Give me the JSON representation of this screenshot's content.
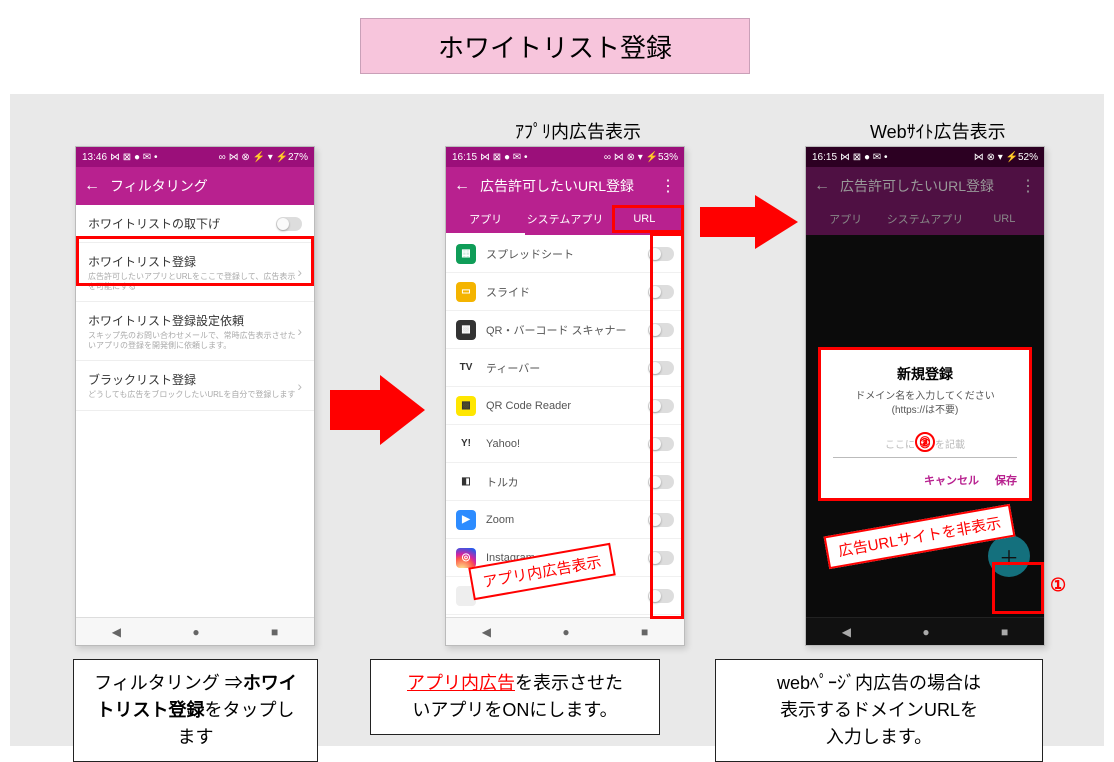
{
  "title": "ホワイトリスト登録",
  "column_labels": {
    "middle": "ｱﾌﾟﾘ内広告表示",
    "right": "Webｻｲﾄ広告表示"
  },
  "phone1": {
    "status_time": "13:46",
    "status_icons_left": "⋈ ⊠ ● ✉ •",
    "status_icons_right": "∞ ⋈ ⊗ ⚡ ▾ ⚡27%",
    "appbar_title": "フィルタリング",
    "items": [
      {
        "title": "ホワイトリストの取下げ",
        "sub": "",
        "type": "toggle"
      },
      {
        "title": "ホワイトリスト登録",
        "sub": "広告許可したいアプリとURLをここで登録して、広告表示を可能にする",
        "type": "chevron"
      },
      {
        "title": "ホワイトリスト登録設定依頼",
        "sub": "スキップ先のお問い合わせメールで、常時広告表示させたいアプリの登録を開発側に依頼します。",
        "type": "chevron"
      },
      {
        "title": "ブラックリスト登録",
        "sub": "どうしても広告をブロックしたいURLを自分で登録します",
        "type": "chevron"
      }
    ]
  },
  "phone2": {
    "status_time": "16:15",
    "status_icons_left": "⋈ ⊠ ● ✉ •",
    "status_icons_right": "∞ ⋈ ⊗ ▾ ⚡53%",
    "appbar_title": "広告許可したいURL登録",
    "tabs": [
      "アプリ",
      "システムアプリ",
      "URL"
    ],
    "active_tab_index": 0,
    "url_tab": "URL",
    "apps": [
      {
        "name": "スプレッドシート",
        "color": "#0f9d58",
        "glyph": "▦"
      },
      {
        "name": "スライド",
        "color": "#f4b400",
        "glyph": "▭"
      },
      {
        "name": "QR・バーコード スキャナー",
        "color": "#333333",
        "glyph": "▩"
      },
      {
        "name": "ティーバー",
        "color": "#ffffff",
        "glyph": "TV"
      },
      {
        "name": "QR Code Reader",
        "color": "#ffe600",
        "glyph": "▩"
      },
      {
        "name": "Yahoo!",
        "color": "#ffffff",
        "glyph": "Y!"
      },
      {
        "name": "トルカ",
        "color": "#ffffff",
        "glyph": "◧"
      },
      {
        "name": "Zoom",
        "color": "#2d8cff",
        "glyph": "▶"
      },
      {
        "name": "Instagram",
        "color": "#ffffff",
        "glyph": "◎"
      }
    ]
  },
  "phone3": {
    "status_time": "16:15",
    "status_icons_left": "⋈ ⊠ ● ✉ •",
    "status_icons_right": "⋈ ⊗ ▾ ⚡52%",
    "appbar_title": "広告許可したいURL登録",
    "tabs": [
      "アプリ",
      "システムアプリ",
      "URL"
    ],
    "dialog": {
      "title": "新規登録",
      "msg_line1": "ドメイン名を入力してください",
      "msg_line2": "(https://は不要)",
      "placeholder_left": "ここに",
      "placeholder_right": "を記載",
      "cancel": "キャンセル",
      "save": "保存"
    }
  },
  "callouts": {
    "middle": "アプリ内広告表示",
    "right": "広告URLサイトを非表示"
  },
  "markers": {
    "one": "①",
    "two": "②"
  },
  "captions": {
    "left_part1": "フィルタリング ⇒",
    "left_bold": "ホワイトリスト登録",
    "left_part3": "をタップします",
    "middle_red": "アプリ内広告",
    "middle_rest1": "を表示させた",
    "middle_rest2": "いアプリをONにします。",
    "right_l1": "webﾍﾟｰｼﾞ内広告の場合は",
    "right_l2": "表示するドメインURLを",
    "right_l3": "入力します。"
  },
  "nav": {
    "back": "◀",
    "home": "●",
    "recent": "■"
  }
}
